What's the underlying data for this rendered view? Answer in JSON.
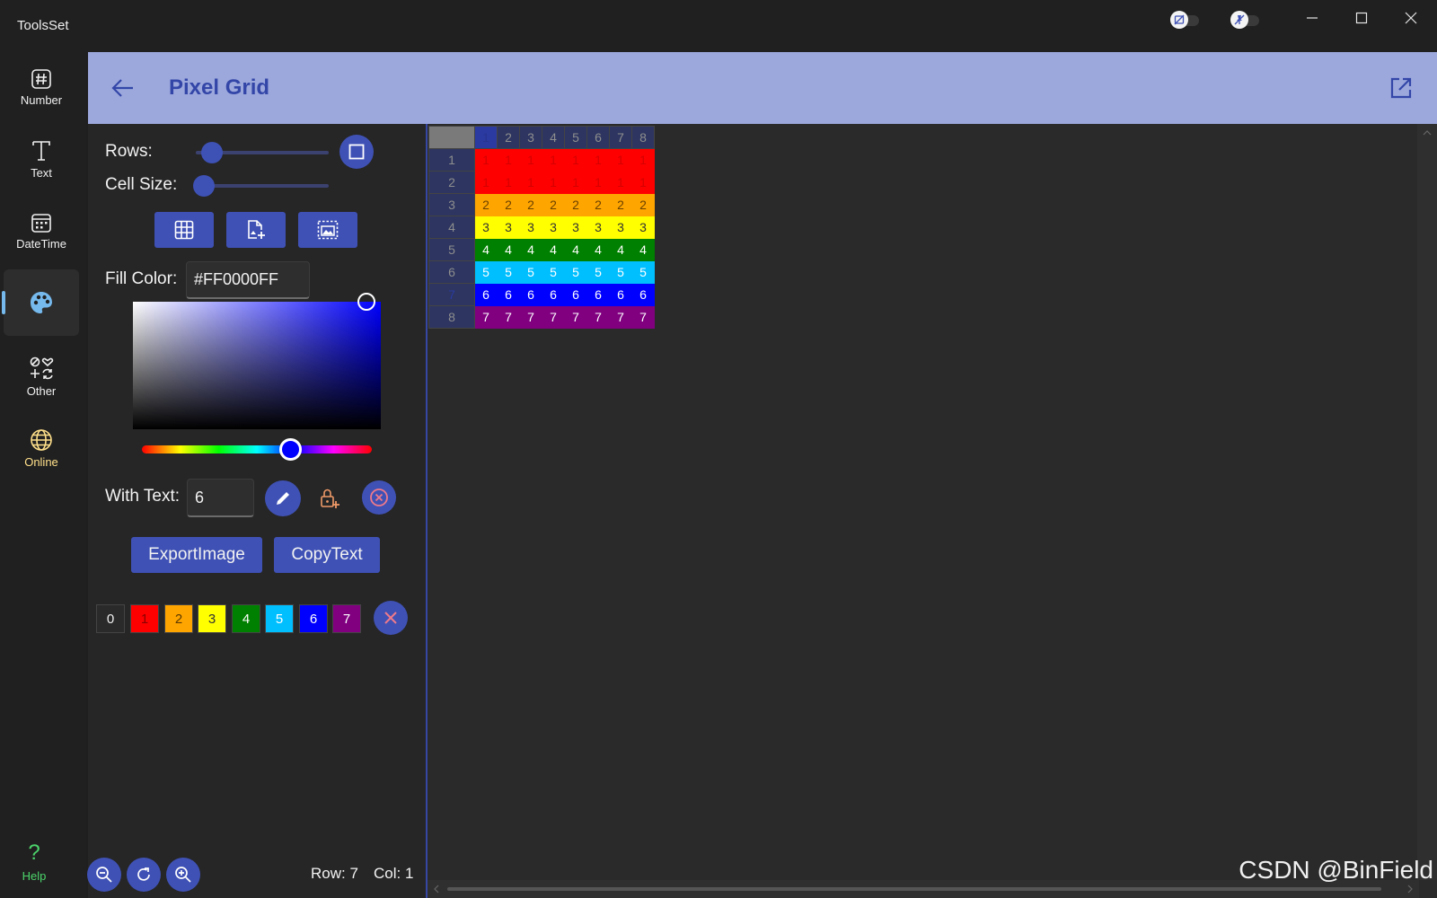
{
  "app": {
    "title": "ToolsSet"
  },
  "nav": {
    "items": [
      {
        "label": "Number",
        "icon": "hash-icon"
      },
      {
        "label": "Text",
        "icon": "text-icon"
      },
      {
        "label": "DateTime",
        "icon": "calendar-icon"
      },
      {
        "label": "",
        "icon": "palette-icon",
        "active": true
      },
      {
        "label": "Other",
        "icon": "shapes-icon"
      },
      {
        "label": "Online",
        "icon": "globe-icon"
      }
    ],
    "help_label": "Help"
  },
  "header": {
    "title": "Pixel Grid"
  },
  "controls": {
    "rows_label": "Rows:",
    "cell_size_label": "Cell Size:",
    "fill_color_label": "Fill Color:",
    "fill_color_value": "#FF0000FF",
    "with_text_label": "With Text:",
    "with_text_value": "6",
    "export_label": "ExportImage",
    "copy_label": "CopyText"
  },
  "palette": [
    {
      "label": "0",
      "bg": "#2a2a2a",
      "fg": "#f0f0f0"
    },
    {
      "label": "1",
      "bg": "#ff0000",
      "fg": "#8a0000"
    },
    {
      "label": "2",
      "bg": "#ffa500",
      "fg": "#5a3a00"
    },
    {
      "label": "3",
      "bg": "#ffff00",
      "fg": "#333333"
    },
    {
      "label": "4",
      "bg": "#008000",
      "fg": "#ffffff"
    },
    {
      "label": "5",
      "bg": "#00bfff",
      "fg": "#ffffff"
    },
    {
      "label": "6",
      "bg": "#0000ff",
      "fg": "#ffffff"
    },
    {
      "label": "7",
      "bg": "#800080",
      "fg": "#ffffff"
    }
  ],
  "grid": {
    "col_headers": [
      "1",
      "2",
      "3",
      "4",
      "5",
      "6",
      "7",
      "8"
    ],
    "row_headers": [
      "1",
      "2",
      "3",
      "4",
      "5",
      "6",
      "7",
      "8"
    ],
    "rows": [
      [
        "1",
        "1",
        "1",
        "1",
        "1",
        "1",
        "1",
        "1"
      ],
      [
        "1",
        "1",
        "1",
        "1",
        "1",
        "1",
        "1",
        "1"
      ],
      [
        "2",
        "2",
        "2",
        "2",
        "2",
        "2",
        "2",
        "2"
      ],
      [
        "3",
        "3",
        "3",
        "3",
        "3",
        "3",
        "3",
        "3"
      ],
      [
        "4",
        "4",
        "4",
        "4",
        "4",
        "4",
        "4",
        "4"
      ],
      [
        "5",
        "5",
        "5",
        "5",
        "5",
        "5",
        "5",
        "5"
      ],
      [
        "6",
        "6",
        "6",
        "6",
        "6",
        "6",
        "6",
        "6"
      ],
      [
        "7",
        "7",
        "7",
        "7",
        "7",
        "7",
        "7",
        "7"
      ]
    ],
    "row_colors": [
      {
        "bg": "#ff0000",
        "fg": "#d50000"
      },
      {
        "bg": "#ff0000",
        "fg": "#d50000"
      },
      {
        "bg": "#ffa500",
        "fg": "#6b4200"
      },
      {
        "bg": "#ffff00",
        "fg": "#333333"
      },
      {
        "bg": "#008000",
        "fg": "#ffffff"
      },
      {
        "bg": "#00bfff",
        "fg": "#ffffff"
      },
      {
        "bg": "#0000ff",
        "fg": "#ffffff"
      },
      {
        "bg": "#800080",
        "fg": "#ffffff"
      }
    ]
  },
  "status": {
    "row": "Row: 7",
    "col": "Col: 1"
  },
  "watermark": "CSDN @BinField"
}
